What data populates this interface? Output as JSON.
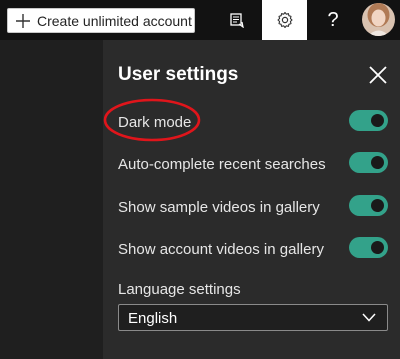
{
  "topbar": {
    "create_button_label": "Create unlimited account",
    "icons": {
      "plus": "plus-icon",
      "feedback": "feedback-icon",
      "settings": "gear-icon",
      "help": "help-icon",
      "avatar": "avatar"
    },
    "help_glyph": "?"
  },
  "panel": {
    "title": "User settings",
    "toggles": [
      {
        "label": "Dark mode",
        "on": true
      },
      {
        "label": "Auto-complete recent searches",
        "on": true
      },
      {
        "label": "Show sample videos in gallery",
        "on": true
      },
      {
        "label": "Show account videos in gallery",
        "on": true
      }
    ],
    "language": {
      "label": "Language settings",
      "selected": "English"
    }
  },
  "colors": {
    "toggle_on": "#33a28a",
    "panel_bg": "#2b2b2b",
    "annotation": "#e0151b"
  }
}
